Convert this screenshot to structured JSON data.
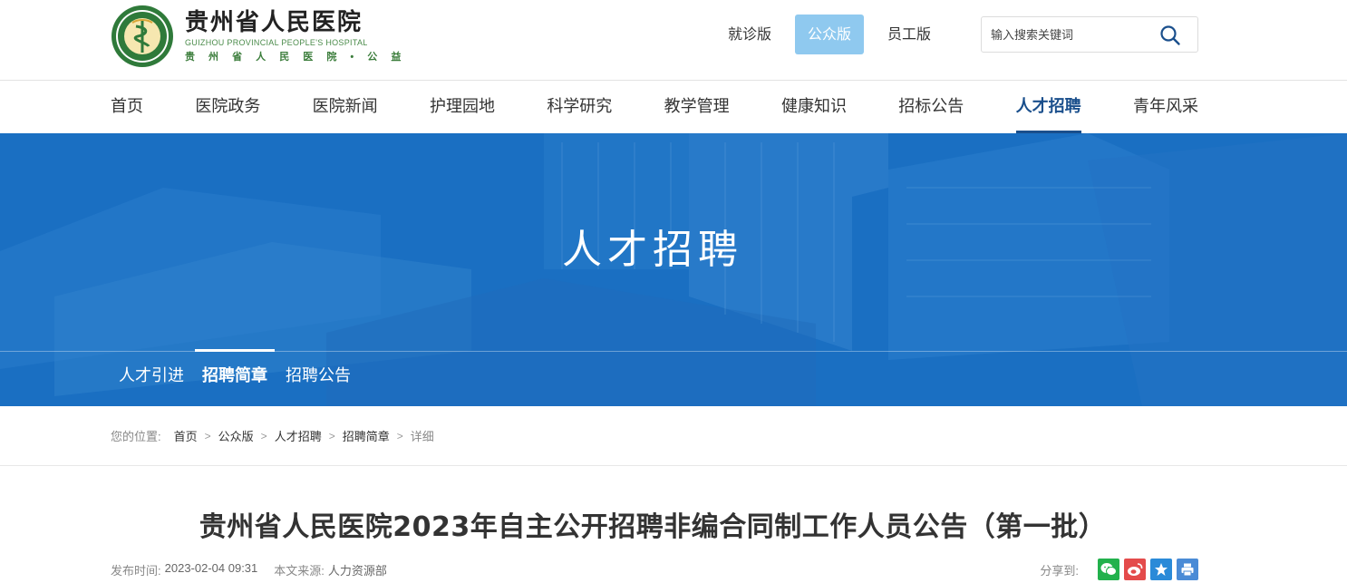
{
  "header": {
    "logo_name": "贵州省人民医院",
    "logo_en": "GUIZHOU PROVINCIAL PEOPLE'S HOSPITAL",
    "logo_sub": "贵 州 省 人 民 医 院 • 公 益",
    "versions": [
      "就诊版",
      "公众版",
      "员工版"
    ],
    "active_version": "公众版",
    "search_placeholder": "输入搜索关键词",
    "search_icon": "search-icon"
  },
  "nav": {
    "items": [
      "首页",
      "医院政务",
      "医院新闻",
      "护理园地",
      "科学研究",
      "教学管理",
      "健康知识",
      "招标公告",
      "人才招聘",
      "青年风采"
    ],
    "active": "人才招聘"
  },
  "banner": {
    "title": "人才招聘",
    "subnav": [
      "人才引进",
      "招聘简章",
      "招聘公告"
    ],
    "active_sub": "招聘简章"
  },
  "breadcrumb": {
    "label": "您的位置:",
    "items": [
      "首页",
      "公众版",
      "人才招聘",
      "招聘简章",
      "详细"
    ]
  },
  "article": {
    "title": "贵州省人民医院2023年自主公开招聘非编合同制工作人员公告（第一批）",
    "publish_label": "发布时间:",
    "publish_time": "2023-02-04 09:31",
    "source_label": "本文来源:",
    "source": "人力资源部",
    "share_label": "分享到:",
    "share_icons": [
      "wechat-icon",
      "weibo-icon",
      "qzone-icon",
      "print-icon"
    ]
  },
  "colors": {
    "nav_active": "#1a4f8c",
    "banner": "#1a73c7",
    "version_active": "#8fc9ef"
  }
}
